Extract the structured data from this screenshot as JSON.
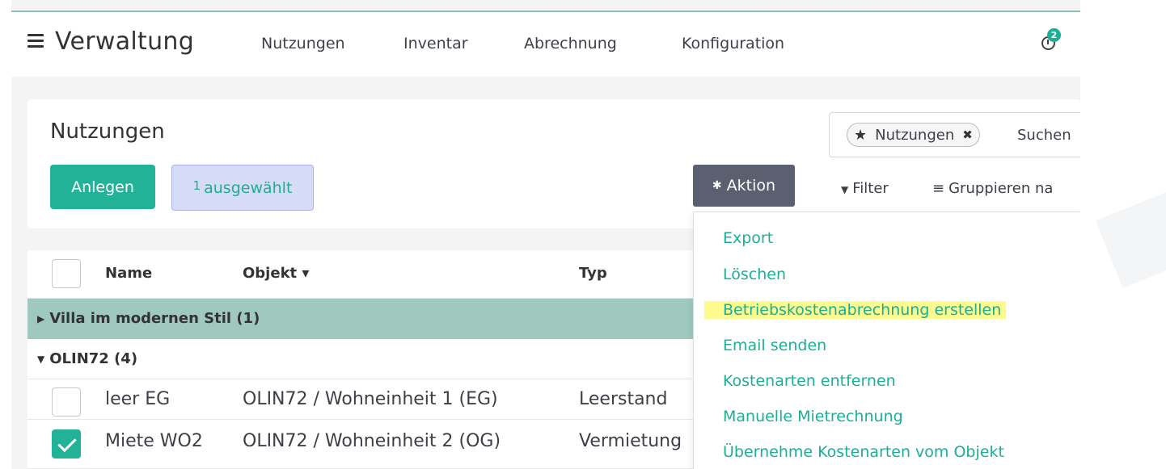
{
  "navbar": {
    "brand": "Verwaltung",
    "menu": [
      {
        "label": "Nutzungen"
      },
      {
        "label": "Inventar"
      },
      {
        "label": "Abrechnung"
      },
      {
        "label": "Konfiguration"
      }
    ],
    "activity_count": "2",
    "icons": {
      "menu": "hamburger-icon",
      "activity": "clock-icon"
    }
  },
  "control_panel": {
    "breadcrumb": "Nutzungen",
    "create_label": "Anlegen",
    "selected_count": "1",
    "selected_label": "ausgewählt",
    "action_label": "Aktion",
    "filter_label": "Filter",
    "group_by_label": "Gruppieren na",
    "search": {
      "facet_label": "Nutzungen",
      "facet_icon": "star-icon",
      "placeholder": "Suchen"
    }
  },
  "action_menu": {
    "items": [
      {
        "label": "Export"
      },
      {
        "label": "Löschen"
      },
      {
        "label": "Betriebskostenabrechnung erstellen",
        "highlighted": true
      },
      {
        "label": "Email senden"
      },
      {
        "label": "Kostenarten entfernen"
      },
      {
        "label": "Manuelle Mietrechnung"
      },
      {
        "label": "Übernehme Kostenarten vom Objekt"
      }
    ]
  },
  "list": {
    "columns": [
      {
        "label": "Name"
      },
      {
        "label": "Objekt ▾"
      },
      {
        "label": "Typ"
      }
    ],
    "groups": [
      {
        "label": "Villa im modernen Stil (1)",
        "expanded": false
      },
      {
        "label": "OLIN72 (4)",
        "expanded": true
      }
    ],
    "rows": [
      {
        "name": "leer EG",
        "objekt": "OLIN72 / Wohneinheit 1 (EG)",
        "typ": "Leerstand",
        "checked": false
      },
      {
        "name": "Miete WO2",
        "objekt": "OLIN72 / Wohneinheit 2 (OG)",
        "typ": "Vermietung",
        "checked": true
      }
    ]
  },
  "colors": {
    "accent": "#22b297",
    "group_header": "#9fc9bf",
    "action_button": "#5b6070",
    "selected_pill": "#d7dcf6",
    "highlight": "#fdfb8e"
  }
}
